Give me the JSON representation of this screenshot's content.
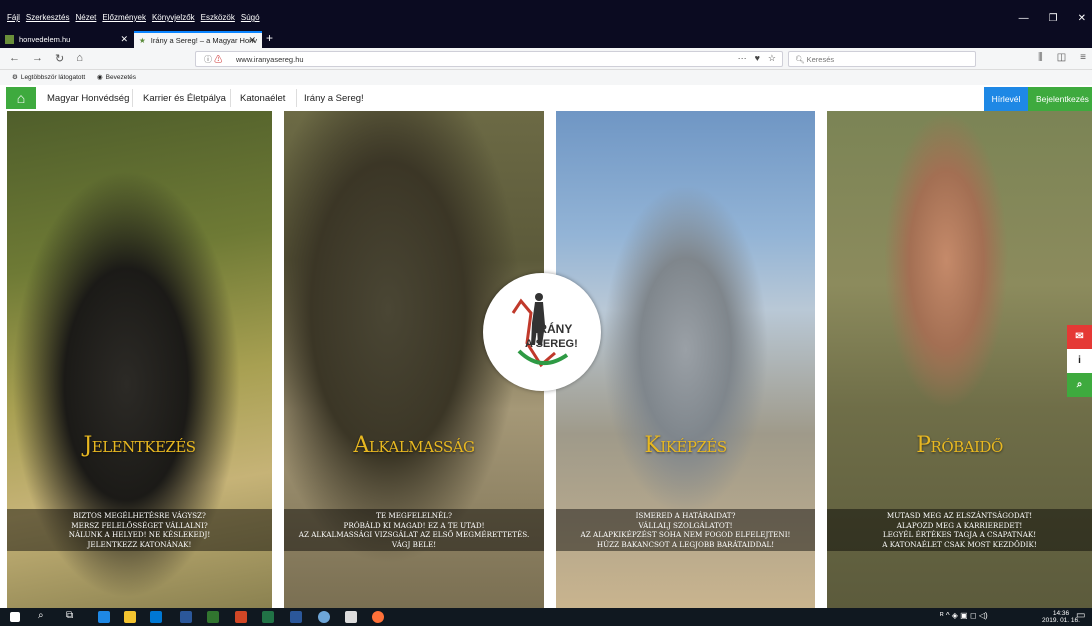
{
  "menubar": {
    "items": [
      "Fájl",
      "Szerkesztés",
      "Nézet",
      "Előzmények",
      "Könyvjelzők",
      "Eszközök",
      "Súgó"
    ]
  },
  "tabs": [
    {
      "label": "honvedelem.hu"
    },
    {
      "label": "Irány a Sereg! – a Magyar Honv"
    }
  ],
  "navbar": {
    "url": "www.iranyasereg.hu",
    "search_placeholder": "Keresés"
  },
  "bookmarks": [
    "Legtöbbször látogatott",
    "Bevezetés"
  ],
  "site_nav": {
    "home_icon": "home-icon",
    "items": [
      "Magyar Honvédség",
      "Karrier és Életpálya",
      "Katonaélet",
      "Irány a Sereg!"
    ],
    "newsletter": "Hírlevél",
    "login": "Bejelentkezés"
  },
  "logo": {
    "line1": "IRÁNY",
    "line2": "A SEREG!"
  },
  "panels": [
    {
      "title": "Jelentkezés",
      "desc": [
        "Biztos megélhetésre vágysz?",
        "Mersz felelősséget vállalni?",
        "Nálunk a helyed! Ne késlekedj!",
        "Jelentkezz katonának!"
      ]
    },
    {
      "title": "Alkalmasság",
      "desc": [
        "Te megfelelnél?",
        "Próbáld ki magad! Ez a te utad!",
        "Az alkalmassági vizsgálat az első megmérettetés.",
        "Vágj bele!"
      ]
    },
    {
      "title": "Kiképzés",
      "desc": [
        "Ismered a határaidat?",
        "Vállalj szolgálatot!",
        "Az alapkiképzést soha nem fogod elfelejteni!",
        "Húzz bakancsot a legjobb barátaiddal!"
      ]
    },
    {
      "title": "Próbaidő",
      "desc": [
        "Mutasd meg az elszántságodat!",
        "Alapozd meg a karrieredet!",
        "Legyél értékes tagja a csapatnak!",
        "A katonaélet csak most kezdődik!"
      ]
    }
  ],
  "side_buttons": [
    {
      "icon": "mail-icon",
      "color": "#e53935"
    },
    {
      "icon": "info-icon",
      "color": "#ffffff",
      "label": "i"
    },
    {
      "icon": "search-icon",
      "color": "#3eaa3e"
    }
  ],
  "taskbar": {
    "time": "14:36",
    "date": "2019. 01. 16."
  }
}
